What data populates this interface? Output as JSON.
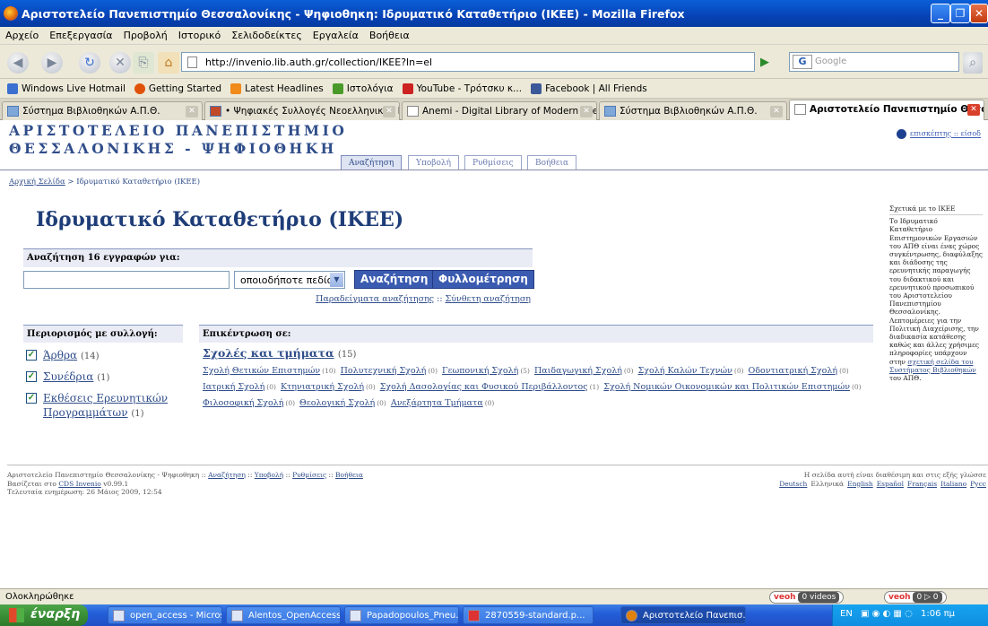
{
  "window": {
    "title": "Αριστοτελείο Πανεπιστημίο Θεσσαλονίκης - Ψηφιοθηκη: Ιδρυματικό Καταθετήριο (ΙΚΕΕ) - Mozilla Firefox"
  },
  "menubar": [
    "Αρχείο",
    "Επεξεργασία",
    "Προβολή",
    "Ιστορικό",
    "Σελιδοδείκτες",
    "Εργαλεία",
    "Βοήθεια"
  ],
  "navbar": {
    "url": "http://invenio.lib.auth.gr/collection/IKEE?ln=el",
    "search_placeholder": "Google",
    "search_engine": "G"
  },
  "bookmarks": [
    {
      "label": "Windows Live Hotmail",
      "color": "#3b6fd0"
    },
    {
      "label": "Getting Started",
      "color": "#e0520a"
    },
    {
      "label": "Latest Headlines",
      "color": "#f08a1a"
    },
    {
      "label": "Ιστολόγια",
      "color": "#4a9a2a"
    },
    {
      "label": "YouTube - Τρότσκυ κ...",
      "color": "#cc2222"
    },
    {
      "label": "Facebook | All Friends",
      "color": "#3b5998"
    }
  ],
  "tabs": [
    {
      "label": "Σύστημα Βιβλιοθηκών Α.Π.Θ.",
      "active": false
    },
    {
      "label": "• Ψηφιακές Συλλογές Νεοελληνικής Γ...",
      "active": false
    },
    {
      "label": "Anemi - Digital Library of Modern Gree...",
      "active": false
    },
    {
      "label": "Σύστημα Βιβλιοθηκών Α.Π.Θ.",
      "active": false
    },
    {
      "label": "Αριστοτελείο Πανεπιστημίο Θεσσ...",
      "active": true
    }
  ],
  "site": {
    "banner_line1": "ΑΡΙΣΤΟΤΕΛΕΙΟ ΠΑΝΕΠΙΣΤΗΜΙΟ",
    "banner_line2": "ΘΕΣΣΑΛΟΝΙΚΗΣ - ΨΗΦΙΟΘΗΚΗ",
    "user_link": "επισκέπτης :: είσοδ",
    "subnav": [
      {
        "label": "Αναζήτηση",
        "active": true
      },
      {
        "label": "Υποβολή",
        "active": false
      },
      {
        "label": "Ρυθμίσεις",
        "active": false
      },
      {
        "label": "Βοήθεια",
        "active": false
      }
    ],
    "breadcrumb_home": "Αρχική Σελίδα",
    "breadcrumb_sep": " > ",
    "breadcrumb_current": "Ιδρυματικό Καταθετήριο (ΙΚΕΕ)",
    "page_title": "Ιδρυματικό Καταθετήριο (ΙΚΕΕ)"
  },
  "search": {
    "header": "Αναζήτηση 16 εγγραφών για:",
    "input_value": "",
    "field_select": "οποιοδήποτε πεδίο",
    "search_button": "Αναζήτηση",
    "browse_button": "Φυλλομέτρηση",
    "examples_link": "Παραδείγματα αναζήτησης",
    "examples_sep": " :: ",
    "advanced_link": "Σύνθετη αναζήτηση"
  },
  "collections": {
    "header": "Περιορισμός με συλλογή:",
    "items": [
      {
        "label": "Άρθρα",
        "count": "(14)",
        "checked": true
      },
      {
        "label": "Συνέδρια",
        "count": "(1)",
        "checked": true
      },
      {
        "label": "Εκθέσεις Ερευνητικών Προγραμμάτων",
        "count": "(1)",
        "checked": true
      }
    ]
  },
  "focus": {
    "header": "Επικέντρωση σε:",
    "main_label": "Σχολές και τμήματα",
    "main_count": "(15)",
    "schools": [
      {
        "label": "Σχολή Θετικών Επιστημών",
        "count": "(10)"
      },
      {
        "label": "Πολυτεχνική Σχολή",
        "count": "(0)"
      },
      {
        "label": "Γεωπονική Σχολή",
        "count": "(5)"
      },
      {
        "label": "Παιδαγωγική Σχολή",
        "count": "(0)"
      },
      {
        "label": "Σχολή Καλών Τεχνών",
        "count": "(0)"
      },
      {
        "label": "Οδοντιατρική Σχολή",
        "count": "(0)"
      },
      {
        "label": "Ιατρική Σχολή",
        "count": "(0)"
      },
      {
        "label": "Κτηνιατρική Σχολή",
        "count": "(0)"
      },
      {
        "label": "Σχολή Δασολογίας και Φυσικού Περιβάλλοντος",
        "count": "(1)"
      },
      {
        "label": "Σχολή Νομικών Οικονομικών και Πολιτικών Επιστημών",
        "count": "(0)"
      },
      {
        "label": "Φιλοσοφική Σχολή",
        "count": "(0)"
      },
      {
        "label": "Θεολογική Σχολή",
        "count": "(0)"
      },
      {
        "label": "Ανεξάρτητα Τμήματα",
        "count": "(0)"
      }
    ]
  },
  "aside": {
    "title": "Σχετικά με το ΙΚΕΕ",
    "text": "Το Ιδρυματικό Καταθετήριο Επιστημονικών Εργασιών του ΑΠΘ είναι ένας χώρος συγκέντρωσης, διαφύλαξης και διάδοσης της ερευνητικής παραγωγής του διδακτικού και ερευνητικού προσωπικού του Αριστοτελείου Πανεπιστημίου Θεσσαλονίκης. Λεπτομέρειες για την Πολιτική Διαχείρισης, την διαδικασία κατάθεσης καθώς και άλλες χρήσιμες πληροφορίες υπάρχουν στην",
    "link": "σχετική σελίδα του Συστήματος Βιβλιοθηκών",
    "tail": "του ΑΠΘ."
  },
  "footer": {
    "prefix": "Αριστοτελείο Πανεπιστημίο Θεσσαλονίκης - Ψηφιοθηκη ::",
    "links": [
      "Αναζήτηση",
      "Υποβολή",
      "Ρυθμίσεις",
      "Βοήθεια"
    ],
    "sep": " :: ",
    "based_on": "Βασίζεται στο",
    "cds": "CDS Invenio",
    "version": "v0.99.1",
    "updated": "Τελευταία ενημέρωση: 26 Μάιος 2009, 12:54",
    "lang_note": "Η σελίδα αυτή είναι διαθέσιμη και στις εξής γλώσσε",
    "languages": [
      "Deutsch",
      "Ελληνικά",
      "English",
      "Español",
      "Français",
      "Italiano",
      "Русс"
    ]
  },
  "statusbar": {
    "text": "Ολοκληρώθηκε",
    "veoh1_label": "veoh",
    "veoh1_videos": "0 videos",
    "veoh2_label": "veoh",
    "veoh2_counts": "0 ▷ 0"
  },
  "taskbar": {
    "start": "έναρξη",
    "tasks": [
      {
        "label": "open_access - Micros...",
        "active": false
      },
      {
        "label": "Alentos_OpenAccess...",
        "active": false
      },
      {
        "label": "Papadopoulos_Pneu...",
        "active": false
      },
      {
        "label": "2870559-standard.p...",
        "active": false
      },
      {
        "label": "Αριστοτελείο Πανεπισ...",
        "active": true
      }
    ],
    "tray_lang": "EN",
    "clock": "1:06 πμ"
  }
}
